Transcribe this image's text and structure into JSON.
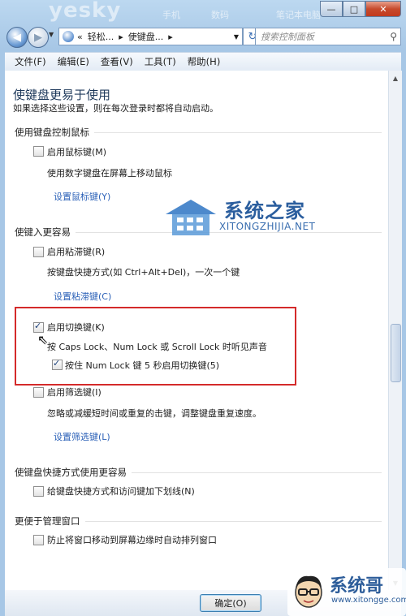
{
  "titlebar": {
    "watermark": "yesky",
    "wm_items": [
      "手机",
      "数码",
      "笔记本电脑"
    ],
    "min": "—",
    "max": "□",
    "close": "✕"
  },
  "address": {
    "back": "◀",
    "forward": "▶",
    "crumbs": [
      "«",
      "轻松...",
      "▸",
      "使键盘...",
      "▸"
    ],
    "search_placeholder": "搜索控制面板"
  },
  "menu": [
    "文件(F)",
    "编辑(E)",
    "查看(V)",
    "工具(T)",
    "帮助(H)"
  ],
  "page": {
    "title": "使键盘更易于使用",
    "subtitle": "如果选择这些设置，则在每次登录时都将自动启动。"
  },
  "sections": {
    "mouse": {
      "header": "使用键盘控制鼠标",
      "checkbox": "启用鼠标键(M)",
      "desc": "使用数字键盘在屏幕上移动鼠标",
      "link": "设置鼠标键(Y)"
    },
    "typing": {
      "header": "使键入更容易",
      "sticky_checkbox": "启用粘滞键(R)",
      "sticky_desc": "按键盘快捷方式(如 Ctrl+Alt+Del)，一次一个键",
      "sticky_link": "设置粘滞键(C)",
      "toggle_checkbox": "启用切换键(K)",
      "toggle_desc": "按 Caps Lock、Num Lock 或 Scroll Lock 时听见声音",
      "toggle_sub_checkbox": "按住 Num Lock 键 5 秒启用切换键(5)",
      "filter_checkbox": "启用筛选键(I)",
      "filter_desc": "忽略或减缓短时间或重复的击键，调整键盘重复速度。",
      "filter_link": "设置筛选键(L)"
    },
    "shortcuts": {
      "header": "使键盘快捷方式使用更容易",
      "checkbox": "给键盘快捷方式和访问键加下划线(N)"
    },
    "windows": {
      "header": "更便于管理窗口",
      "checkbox": "防止将窗口移动到屏幕边缘时自动排列窗口"
    }
  },
  "footer": {
    "ok": "确定(O)"
  },
  "watermark": {
    "name": "系统之家",
    "site": "XITONGZHIJIA.NET"
  },
  "corner_logo": {
    "brand": "系统哥",
    "url": "www.xitongge.com"
  },
  "state": {
    "toggle_keys_checked": true,
    "toggle_sub_checked": true
  },
  "colors": {
    "highlight_box": "#d42a2a",
    "link": "#2d62b8"
  }
}
